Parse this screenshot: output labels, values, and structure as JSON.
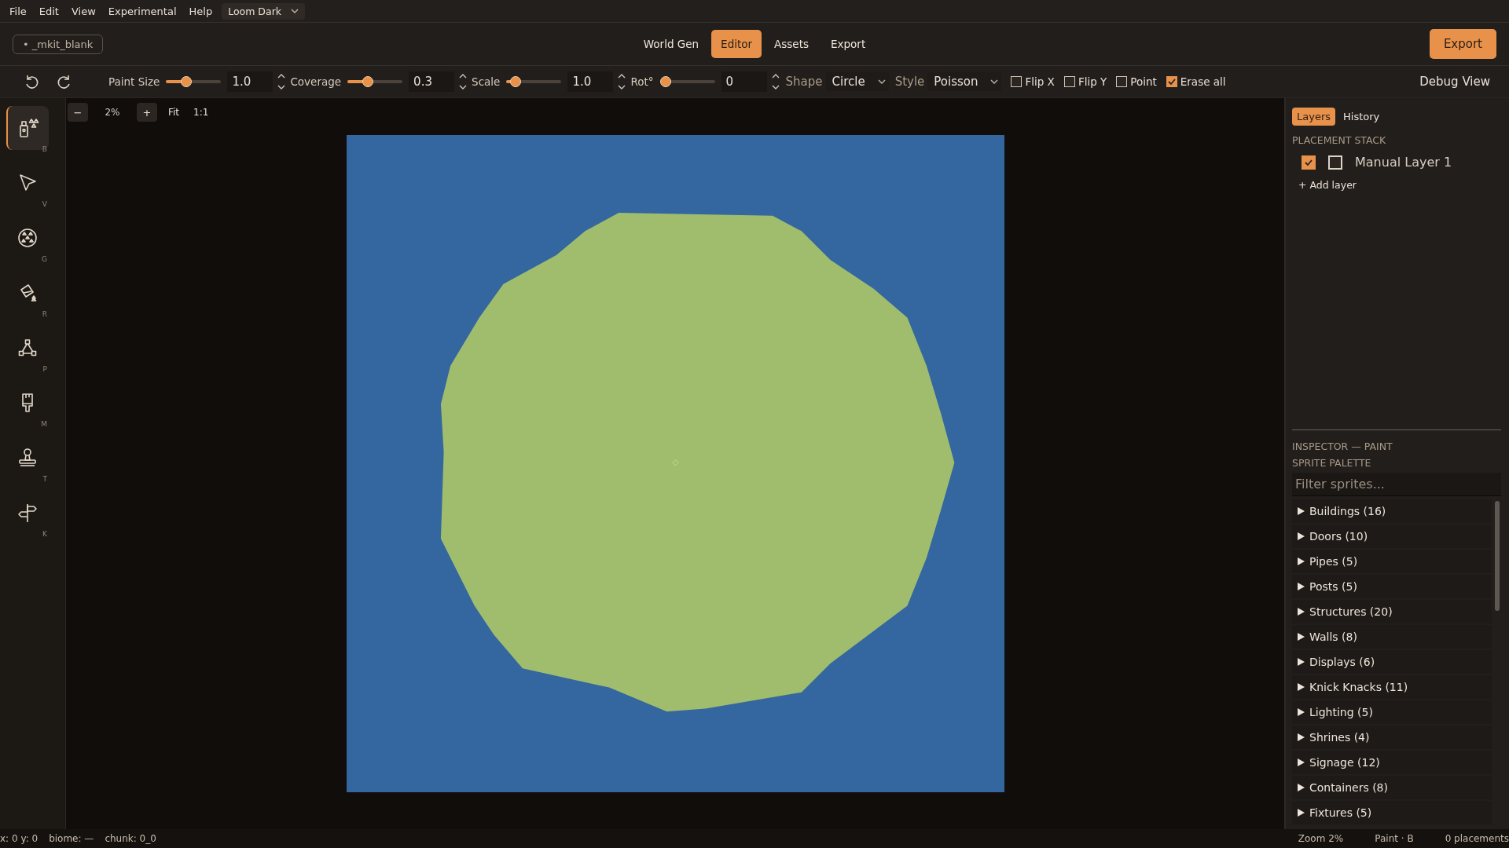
{
  "menu": [
    "File",
    "Edit",
    "View",
    "Experimental",
    "Help"
  ],
  "theme_select": {
    "value": "Loom Dark"
  },
  "document": {
    "name": "• _mkit_blank"
  },
  "nav_tabs": [
    {
      "label": "World Gen",
      "selected": false
    },
    {
      "label": "Editor",
      "selected": true
    },
    {
      "label": "Assets",
      "selected": false
    },
    {
      "label": "Export",
      "selected": false
    }
  ],
  "export_button": "Export",
  "toolbar": {
    "sliders": [
      {
        "label": "Paint Size",
        "level": 0.33,
        "value": "1.0"
      },
      {
        "label": "Coverage",
        "level": 0.33,
        "value": "0.3"
      },
      {
        "label": "Scale",
        "level": 0.09,
        "value": "1.0"
      },
      {
        "label": "Rot°",
        "level": 0.0,
        "value": "0"
      }
    ],
    "selects": [
      {
        "label": "Shape",
        "value": "Circle"
      },
      {
        "label": "Style",
        "value": "Poisson"
      }
    ],
    "checkboxes": [
      {
        "label": "Flip X",
        "checked": false
      },
      {
        "label": "Flip Y",
        "checked": false
      },
      {
        "label": "Point",
        "checked": false
      },
      {
        "label": "Erase all",
        "checked": true
      }
    ],
    "debug_view": "Debug View"
  },
  "zoom_controls": {
    "minus": "−",
    "level": "2%",
    "plus": "+",
    "fit": "Fit",
    "actual": "1:1"
  },
  "tools": [
    {
      "kind": "spray",
      "key": "B",
      "selected": true
    },
    {
      "kind": "pointer",
      "key": "V",
      "selected": false
    },
    {
      "kind": "scatter",
      "key": "G",
      "selected": false
    },
    {
      "kind": "fill",
      "key": "R",
      "selected": false
    },
    {
      "kind": "path",
      "key": "P",
      "selected": false
    },
    {
      "kind": "brush",
      "key": "M",
      "selected": false
    },
    {
      "kind": "stamp",
      "key": "T",
      "selected": false
    },
    {
      "kind": "signpost",
      "key": "K",
      "selected": false
    }
  ],
  "right_panel": {
    "tabs": [
      {
        "label": "Layers",
        "selected": true
      },
      {
        "label": "History",
        "selected": false
      }
    ],
    "stack_heading": "PLACEMENT STACK",
    "layers": [
      {
        "name": "Manual Layer 1",
        "checks": [
          true,
          false
        ]
      }
    ],
    "add_layer": "+ Add layer",
    "inspector_heading": "INSPECTOR — PAINT",
    "palette_heading": "SPRITE PALETTE",
    "filter_placeholder": "Filter sprites...",
    "categories": [
      {
        "label": "Buildings (16)",
        "expanded": false
      },
      {
        "label": "Doors (10)",
        "expanded": false
      },
      {
        "label": "Pipes (5)",
        "expanded": false
      },
      {
        "label": "Posts (5)",
        "expanded": false
      },
      {
        "label": "Structures (20)",
        "expanded": false
      },
      {
        "label": "Walls (8)",
        "expanded": false
      },
      {
        "label": "Displays (6)",
        "expanded": false
      },
      {
        "label": "Knick Knacks (11)",
        "expanded": false
      },
      {
        "label": "Lighting (5)",
        "expanded": false
      },
      {
        "label": "Shrines (4)",
        "expanded": false
      },
      {
        "label": "Signage (12)",
        "expanded": false
      },
      {
        "label": "Containers (8)",
        "expanded": false
      },
      {
        "label": "Fixtures (5)",
        "expanded": false
      }
    ]
  },
  "status_bar": {
    "left": [
      "x: 0  y: 0",
      "biome: —",
      "chunk: 0_0"
    ],
    "right": [
      "Zoom 2%",
      "Paint · B",
      "0 placements"
    ]
  }
}
